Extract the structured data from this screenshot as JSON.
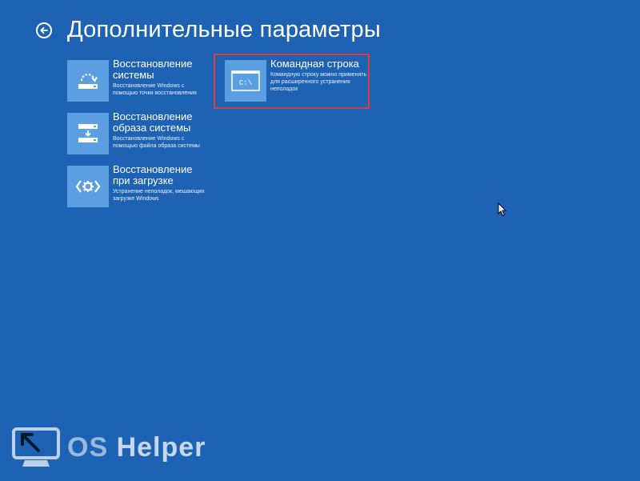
{
  "header": {
    "title": "Дополнительные параметры"
  },
  "tiles": [
    {
      "title": "Восстановление системы",
      "desc": "Восстановление Windows с помощью точки восстановления",
      "icon": "system-restore-icon"
    },
    {
      "title": "Восстановление образа системы",
      "desc": "Восстановление Windows с помощью файла образа системы",
      "icon": "system-image-icon"
    },
    {
      "title": "Восстановление при загрузке",
      "desc": "Устранение неполадок, мешающих загрузке Windows",
      "icon": "startup-repair-icon"
    },
    {
      "title": "Командная строка",
      "desc": "Командную строку можно применять для расширенного устранения неполадок",
      "icon": "command-prompt-icon",
      "icon_text": "C:\\"
    }
  ],
  "watermark": {
    "os": "OS",
    "helper": "Helper"
  },
  "colors": {
    "background": "#1e62b4",
    "tile": "#5b9fe0",
    "highlight": "#e03c3c"
  }
}
